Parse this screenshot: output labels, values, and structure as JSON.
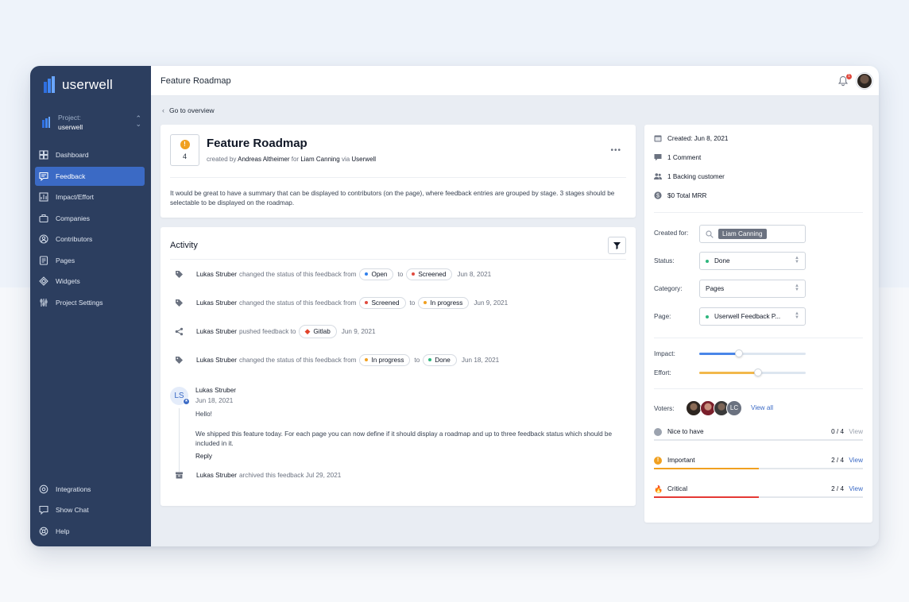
{
  "sidebar": {
    "logo_text": "userwell",
    "project_label": "Project:",
    "project_name": "userwell",
    "items": [
      {
        "label": "Dashboard",
        "icon": "dashboard-icon"
      },
      {
        "label": "Feedback",
        "icon": "feedback-icon",
        "active": true
      },
      {
        "label": "Impact/Effort",
        "icon": "impact-effort-icon"
      },
      {
        "label": "Companies",
        "icon": "companies-icon"
      },
      {
        "label": "Contributors",
        "icon": "contributors-icon"
      },
      {
        "label": "Pages",
        "icon": "pages-icon"
      },
      {
        "label": "Widgets",
        "icon": "widgets-icon"
      },
      {
        "label": "Project Settings",
        "icon": "settings-icon"
      }
    ],
    "bottom_items": [
      {
        "label": "Integrations",
        "icon": "integrations-icon"
      },
      {
        "label": "Show Chat",
        "icon": "chat-icon"
      },
      {
        "label": "Help",
        "icon": "help-icon"
      }
    ]
  },
  "topbar": {
    "title": "Feature Roadmap",
    "notification_count": "1"
  },
  "back_link": "Go to overview",
  "feedback": {
    "vote_count": "4",
    "title": "Feature Roadmap",
    "meta_created_by": "created by",
    "author": "Andreas Altheimer",
    "meta_for": "for",
    "for_user": "Liam Canning",
    "meta_via": "via",
    "via": "Userwell",
    "description": "It would be great to have a summary that can be displayed to contributors (on the page), where feedback entries are grouped by stage. 3 stages should be selectable to be displayed on the roadmap."
  },
  "activity": {
    "title": "Activity",
    "events": [
      {
        "who": "Lukas Struber",
        "text": "changed the status of this feedback from",
        "from": "Open",
        "from_color": "#2f80ed",
        "to_word": "to",
        "to": "Screened",
        "to_color": "#e04b3f",
        "date": "Jun 8, 2021"
      },
      {
        "who": "Lukas Struber",
        "text": "changed the status of this feedback from",
        "from": "Screened",
        "from_color": "#e04b3f",
        "to_word": "to",
        "to": "In progress",
        "to_color": "#f0a020",
        "date": "Jun 9, 2021"
      },
      {
        "who": "Lukas Struber",
        "text": "pushed feedback to",
        "target": "Gitlab",
        "date": "Jun 9, 2021"
      },
      {
        "who": "Lukas Struber",
        "text": "changed the status of this feedback from",
        "from": "In progress",
        "from_color": "#f0a020",
        "to_word": "to",
        "to": "Done",
        "to_color": "#2eb67d",
        "date": "Jun 18, 2021"
      }
    ],
    "comment": {
      "initials": "LS",
      "author": "Lukas Struber",
      "date": "Jun 18, 2021",
      "greeting": "Hello!",
      "body": "We shipped this feature today. For each page you can now define if it should display a roadmap and up to three feedback status which should be included in it.",
      "reply": "Reply"
    },
    "archived": {
      "who": "Lukas Struber",
      "text": "archived this feedback Jul 29, 2021"
    }
  },
  "details": {
    "created": "Created: Jun 8, 2021",
    "comments": "1 Comment",
    "backing": "1 Backing customer",
    "mrr": "$0 Total MRR",
    "created_for_label": "Created for:",
    "created_for_value": "Liam Canning",
    "status_label": "Status:",
    "status_value": "Done",
    "status_color": "#2eb67d",
    "category_label": "Category:",
    "category_value": "Pages",
    "page_label": "Page:",
    "page_value": "Userwell Feedback P...",
    "page_color": "#2eb67d",
    "impact_label": "Impact:",
    "impact_value": 0.37,
    "impact_color": "#4a86e8",
    "effort_label": "Effort:",
    "effort_value": 0.55,
    "effort_color": "#f2b84b",
    "voters_label": "Voters:",
    "voter_extra_initials": "LC",
    "view_all": "View all",
    "priorities": [
      {
        "label": "Nice to have",
        "count": "0 / 4",
        "view": "View",
        "value": 0,
        "color": "#9ca3af",
        "icon": "nice-to-have-icon"
      },
      {
        "label": "Important",
        "count": "2 / 4",
        "view": "View",
        "value": 0.5,
        "color": "#f0a020",
        "icon": "important-icon"
      },
      {
        "label": "Critical",
        "count": "2 / 4",
        "view": "View",
        "value": 0.5,
        "color": "#e53935",
        "icon": "critical-icon"
      }
    ]
  }
}
